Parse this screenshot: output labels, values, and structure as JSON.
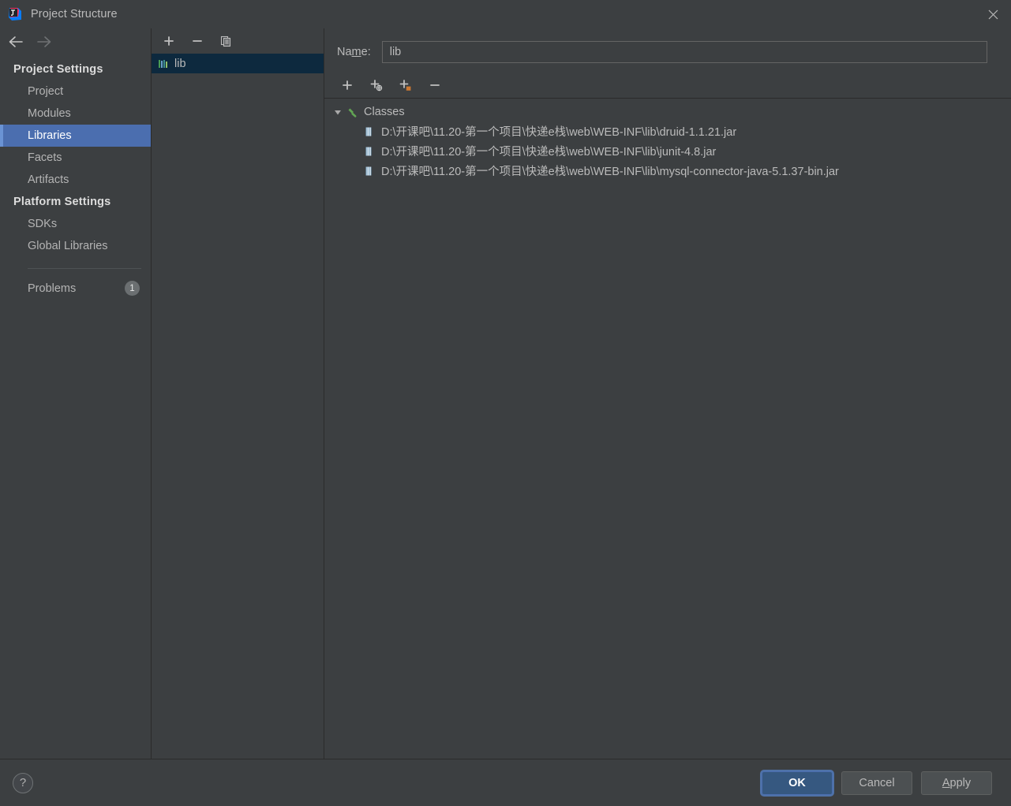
{
  "window": {
    "title": "Project Structure",
    "app_icon": "intellij-idea-icon",
    "close_icon": "close-icon"
  },
  "sidebar": {
    "back_icon": "arrow-left-icon",
    "forward_icon": "arrow-right-icon",
    "sections": [
      {
        "title": "Project Settings",
        "items": [
          {
            "label": "Project",
            "selected": false
          },
          {
            "label": "Modules",
            "selected": false
          },
          {
            "label": "Libraries",
            "selected": true
          },
          {
            "label": "Facets",
            "selected": false
          },
          {
            "label": "Artifacts",
            "selected": false
          }
        ]
      },
      {
        "title": "Platform Settings",
        "items": [
          {
            "label": "SDKs",
            "selected": false
          },
          {
            "label": "Global Libraries",
            "selected": false
          }
        ]
      }
    ],
    "problems": {
      "label": "Problems",
      "count": "1"
    }
  },
  "library_list": {
    "toolbar": [
      {
        "name": "add-library-button",
        "icon": "plus-icon"
      },
      {
        "name": "remove-library-button",
        "icon": "minus-icon"
      },
      {
        "name": "copy-library-button",
        "icon": "copy-icon"
      }
    ],
    "items": [
      {
        "label": "lib",
        "icon": "library-icon",
        "selected": true
      }
    ]
  },
  "detail": {
    "name_label_before": "Na",
    "name_label_mnemonic": "m",
    "name_label_after": "e:",
    "name_value": "lib",
    "name_placeholder": "",
    "toolbar": [
      {
        "name": "add-root-button",
        "icon": "plus-icon"
      },
      {
        "name": "add-from-maven-button",
        "icon": "plus-globe-icon"
      },
      {
        "name": "add-from-disk-button",
        "icon": "plus-jar-icon"
      },
      {
        "name": "remove-root-button",
        "icon": "minus-icon"
      }
    ],
    "tree": {
      "root": {
        "label": "Classes",
        "icon": "classes-root-icon",
        "twisty": "chevron-down-icon",
        "expanded": true
      },
      "children": [
        {
          "label": "D:\\开课吧\\11.20-第一个项目\\快递e栈\\web\\WEB-INF\\lib\\druid-1.1.21.jar",
          "icon": "jar-icon"
        },
        {
          "label": "D:\\开课吧\\11.20-第一个项目\\快递e栈\\web\\WEB-INF\\lib\\junit-4.8.jar",
          "icon": "jar-icon"
        },
        {
          "label": "D:\\开课吧\\11.20-第一个项目\\快递e栈\\web\\WEB-INF\\lib\\mysql-connector-java-5.1.37-bin.jar",
          "icon": "jar-icon"
        }
      ]
    }
  },
  "footer": {
    "help_label": "?",
    "ok_label": "OK",
    "cancel_label": "Cancel",
    "apply_mnemonic": "A",
    "apply_rest": "pply"
  },
  "colors": {
    "background": "#3c3f41",
    "selection_blue": "#4b6eaf",
    "list_selection": "#0d293e",
    "text": "#bbbbbb",
    "primary_button": "#365880",
    "accent_orange": "#cc7832",
    "icon_green": "#6a9955"
  }
}
